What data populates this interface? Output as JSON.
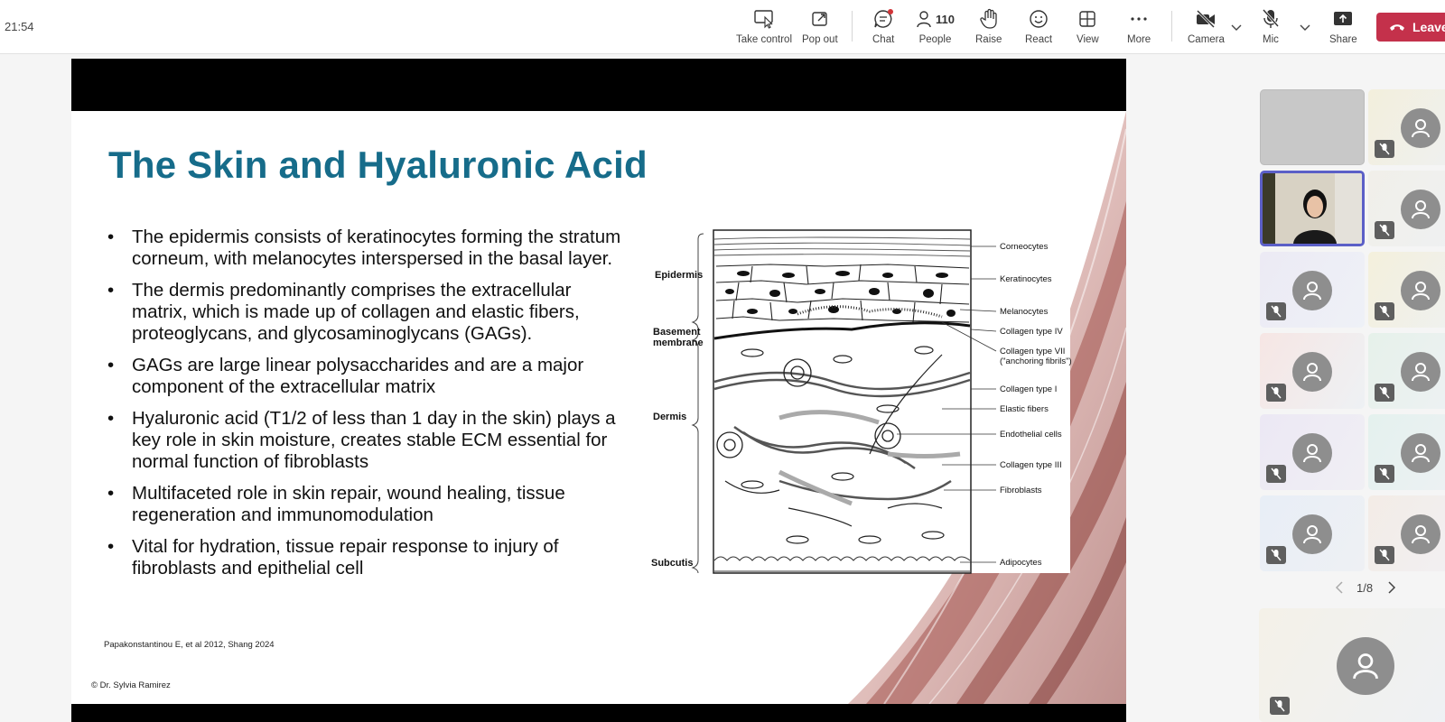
{
  "clock": "21:54",
  "toolbar": {
    "take_control": "Take control",
    "pop_out": "Pop out",
    "chat": "Chat",
    "people": "People",
    "people_count": "110",
    "raise": "Raise",
    "react": "React",
    "view": "View",
    "more": "More",
    "camera": "Camera",
    "mic": "Mic",
    "share": "Share",
    "leave": "Leave"
  },
  "slide": {
    "title": "The Skin and Hyaluronic Acid",
    "bullets": [
      "The epidermis consists of keratinocytes forming the stratum corneum, with melanocytes interspersed in the basal layer.",
      "The dermis predominantly comprises the extracellular matrix, which is made up of collagen and elastic fibers, proteoglycans, and glycosaminoglycans (GAGs).",
      "GAGs are large linear polysaccharides and are a major component of the extracellular matrix",
      "Hyaluronic acid (T1/2 of less than 1 day in the skin) plays a key role in skin moisture, creates stable ECM essential for normal function of fibroblasts",
      "Multifaceted role in skin repair, wound healing, tissue regeneration and immunomodulation",
      "Vital for hydration, tissue repair response to injury of fibroblasts and epithelial cell"
    ],
    "citation": "Papakonstantinou E, et al 2012, Shang 2024",
    "copyright": "© Dr. Sylvia Ramirez",
    "diagram": {
      "left_labels": [
        "Epidermis",
        "Basement membrane",
        "Dermis",
        "Subcutis"
      ],
      "right_labels": [
        "Corneocytes",
        "Keratinocytes",
        "Melanocytes",
        "Collagen type IV",
        "Collagen type VII",
        "(\"anchoring fibrils\")",
        "Collagen type I",
        "Elastic fibers",
        "Endothelial cells",
        "Collagen type III",
        "Fibroblasts",
        "Adipocytes"
      ]
    }
  },
  "gallery": {
    "page": "1/8"
  },
  "colors": {
    "title": "#166c8a",
    "leave": "#c4314b",
    "active_speaker_border": "#5b5fc7"
  }
}
